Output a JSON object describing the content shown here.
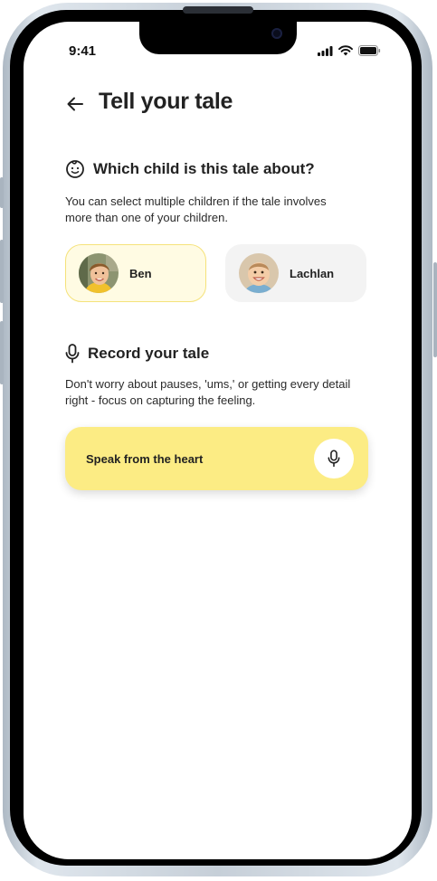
{
  "status_bar": {
    "time": "9:41"
  },
  "header": {
    "title": "Tell your tale"
  },
  "child_section": {
    "title": "Which child is this tale about?",
    "description": "You can select multiple children if the tale involves more than one of your children.",
    "children": [
      {
        "name": "Ben",
        "selected": true
      },
      {
        "name": "Lachlan",
        "selected": false
      }
    ]
  },
  "record_section": {
    "title": "Record your tale",
    "description": "Don't worry about pauses, 'ums,' or getting every detail right - focus on capturing the feeling.",
    "button_label": "Speak from the heart"
  },
  "colors": {
    "accent_yellow": "#fcec84",
    "selected_card_bg": "#fffbe3",
    "selected_card_border": "#f5e27a",
    "unselected_card_bg": "#f3f3f3",
    "text_primary": "#222222"
  },
  "icons": [
    "back-arrow-icon",
    "face-icon",
    "microphone-icon",
    "signal-icon",
    "wifi-icon",
    "battery-icon"
  ]
}
